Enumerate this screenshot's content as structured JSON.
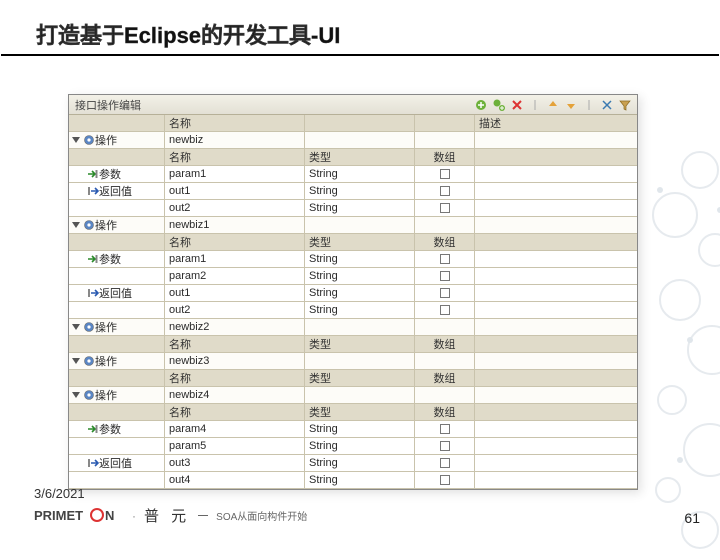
{
  "slide": {
    "title": "打造基于Eclipse的开发工具-UI",
    "date": "3/6/2021",
    "page": "61",
    "brand_cn": "普 元",
    "brand_tag": "SOA从面向构件开始"
  },
  "panel": {
    "title": "接口操作编辑",
    "toolbar": {
      "add": "add",
      "add_child": "add-child",
      "delete": "delete",
      "up": "up",
      "down": "down",
      "spacer": "",
      "collapse": "collapse",
      "filter": "filter"
    },
    "labels": {
      "op": "操作",
      "param": "参数",
      "ret": "返回值",
      "name": "名称",
      "type": "类型",
      "array": "数组",
      "desc": "描述"
    },
    "rows": [
      {
        "t": "h1",
        "c1": "名称",
        "c4": "描述"
      },
      {
        "t": "op",
        "name": "newbiz"
      },
      {
        "t": "h2"
      },
      {
        "t": "p",
        "name": "param1",
        "type": "String"
      },
      {
        "t": "r",
        "name": "out1",
        "type": "String"
      },
      {
        "t": "rv",
        "name": "out2",
        "type": "String"
      },
      {
        "t": "op",
        "name": "newbiz1"
      },
      {
        "t": "h2"
      },
      {
        "t": "p",
        "name": "param1",
        "type": "String"
      },
      {
        "t": "pv",
        "name": "param2",
        "type": "String"
      },
      {
        "t": "r",
        "name": "out1",
        "type": "String"
      },
      {
        "t": "rv",
        "name": "out2",
        "type": "String"
      },
      {
        "t": "op",
        "name": "newbiz2"
      },
      {
        "t": "h2"
      },
      {
        "t": "op",
        "name": "newbiz3"
      },
      {
        "t": "h2"
      },
      {
        "t": "op",
        "name": "newbiz4"
      },
      {
        "t": "h2"
      },
      {
        "t": "p",
        "name": "param4",
        "type": "String"
      },
      {
        "t": "pv",
        "name": "param5",
        "type": "String"
      },
      {
        "t": "r",
        "name": "out3",
        "type": "String"
      },
      {
        "t": "rv",
        "name": "out4",
        "type": "String"
      }
    ]
  }
}
